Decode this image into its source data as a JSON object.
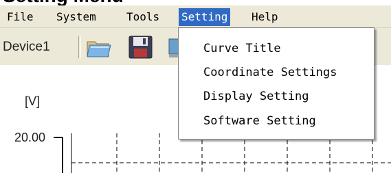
{
  "heading": "Setting Menu",
  "menubar": {
    "items": [
      {
        "label": "File"
      },
      {
        "label": "System"
      },
      {
        "label": "Tools"
      },
      {
        "label": "Setting"
      },
      {
        "label": "Help"
      }
    ],
    "active_index": 3,
    "active_color": "#316ac5"
  },
  "toolbar": {
    "device_label": "Device1",
    "icons": [
      "folder-icon",
      "save-disk-icon",
      "monitor-icon"
    ]
  },
  "setting_menu": {
    "items": [
      {
        "label": "Curve Title"
      },
      {
        "label": "Coordinate Settings"
      },
      {
        "label": "Display Setting"
      },
      {
        "label": "Software Setting"
      }
    ]
  },
  "chart": {
    "ylabel": "[V]",
    "y_top_tick": "20.00",
    "grid": "dashed"
  }
}
